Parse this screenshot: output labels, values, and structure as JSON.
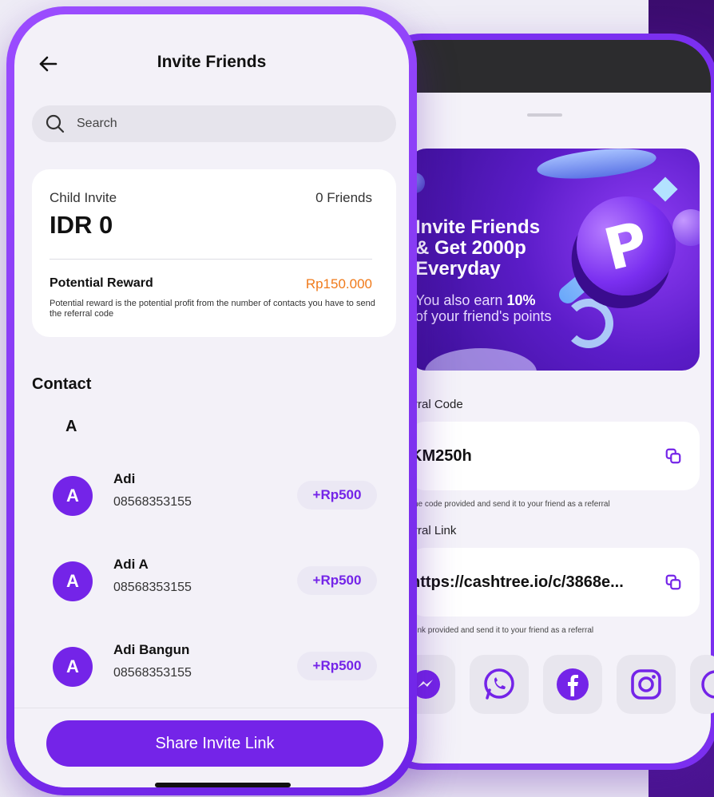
{
  "front": {
    "nav": {
      "title": "Invite Friends",
      "back_icon": "arrow-left-icon"
    },
    "search": {
      "placeholder": "Search",
      "icon": "search-icon"
    },
    "summary": {
      "child_invite_label": "Child Invite",
      "friends_count": "0 Friends",
      "amount": "IDR 0",
      "potential_reward_label": "Potential Reward",
      "potential_reward_value": "Rp150.000",
      "description": "Potential reward is the potential profit from the number of contacts you have to send the referral code"
    },
    "contact_title": "Contact",
    "section_letter": "A",
    "contacts": [
      {
        "initial": "A",
        "name": "Adi",
        "phone": "08568353155",
        "reward": "+Rp500"
      },
      {
        "initial": "A",
        "name": "Adi A",
        "phone": "08568353155",
        "reward": "+Rp500"
      },
      {
        "initial": "A",
        "name": "Adi Bangun",
        "phone": "08568353155",
        "reward": "+Rp500"
      }
    ],
    "share_button": "Share Invite Link"
  },
  "back": {
    "banner": {
      "title": "Invite Friends\n& Get 2000p\nEveryday",
      "sub_prefix": "You also earn ",
      "sub_bold": "10%",
      "sub_suffix": "\nof your friend's points",
      "coin_letter": "P"
    },
    "referral_code_label": "rral Code",
    "referral_code": "KM250h",
    "referral_code_hint": "he code provided and send it to your friend as a referral",
    "referral_link_label": "rral Link",
    "referral_link": "https://cashtree.io/c/3868e...",
    "referral_link_hint": "link provided and send it to your friend as a referral",
    "share_icons": [
      "messenger-icon",
      "whatsapp-icon",
      "facebook-icon",
      "instagram-icon"
    ]
  },
  "colors": {
    "accent": "#7424e8",
    "reward_orange": "#f07a1a",
    "background": "#efedf6"
  }
}
